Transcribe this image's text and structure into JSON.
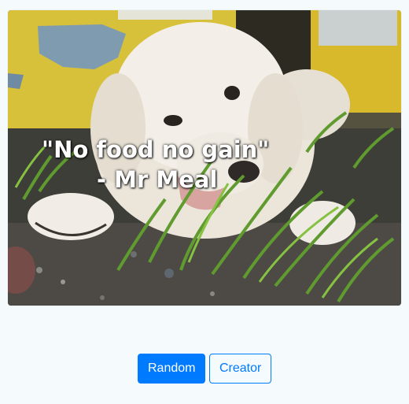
{
  "image": {
    "alt_subject": "photo",
    "caption_quote": "\"No food no gain\"",
    "caption_author": "- Mr Meal"
  },
  "buttons": {
    "random_label": "Random",
    "creator_label": "Creator"
  },
  "colors": {
    "page_background": "#f5fafd",
    "primary": "#007bff",
    "caption_text": "#ffffff"
  }
}
